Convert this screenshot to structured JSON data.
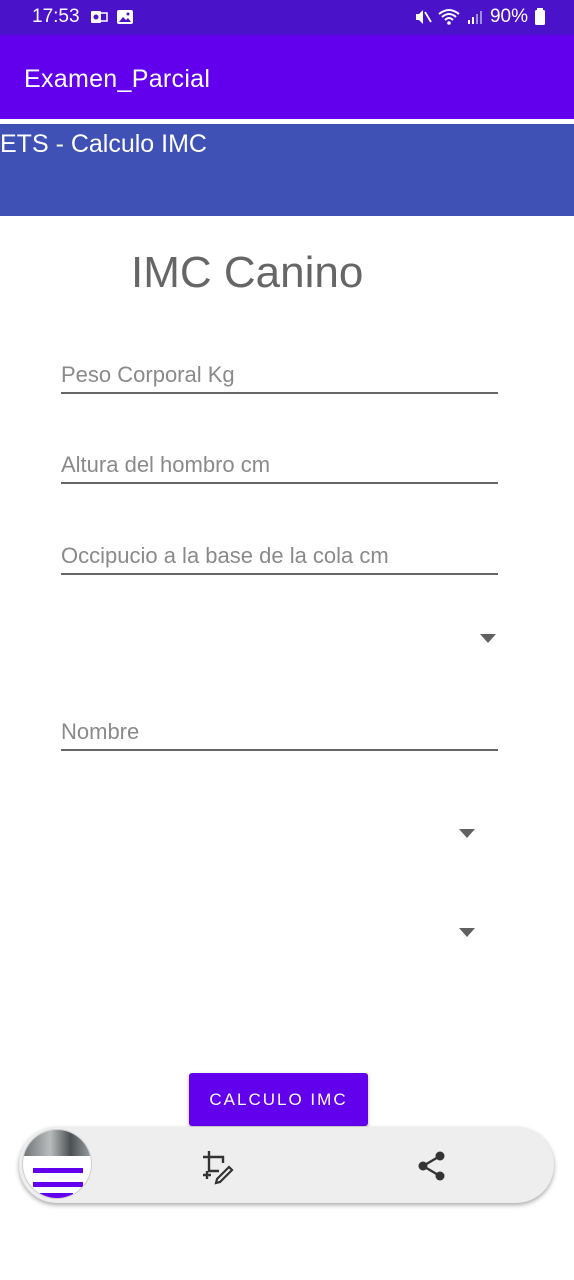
{
  "status_bar": {
    "time": "17:53",
    "battery": "90%",
    "left_icons": [
      "outlook-icon",
      "gallery-icon"
    ],
    "right_icons": [
      "mute-icon",
      "wifi-icon",
      "signal-icon",
      "battery-icon"
    ]
  },
  "app_bar": {
    "title": "Examen_Parcial"
  },
  "secondary_bar": {
    "title": "ETS - Calculo IMC"
  },
  "form": {
    "heading": "IMC Canino",
    "peso_placeholder": "Peso Corporal Kg",
    "altura_placeholder": "Altura del hombro cm",
    "occipucio_placeholder": "Occipucio a la base de la cola cm",
    "nombre_placeholder": "Nombre",
    "spinner_1_value": "",
    "spinner_2_value": "",
    "spinner_3_value": ""
  },
  "button": {
    "label": "CALCULO IMC"
  },
  "screenshot_toolbar": {
    "icons": [
      "screenshot-thumbnail",
      "crop-edit-icon",
      "share-icon"
    ]
  },
  "colors": {
    "status_bar": "#4a12c9",
    "primary": "#6200ee",
    "secondary_bar": "#3f51b5",
    "heading_text": "#666666"
  }
}
